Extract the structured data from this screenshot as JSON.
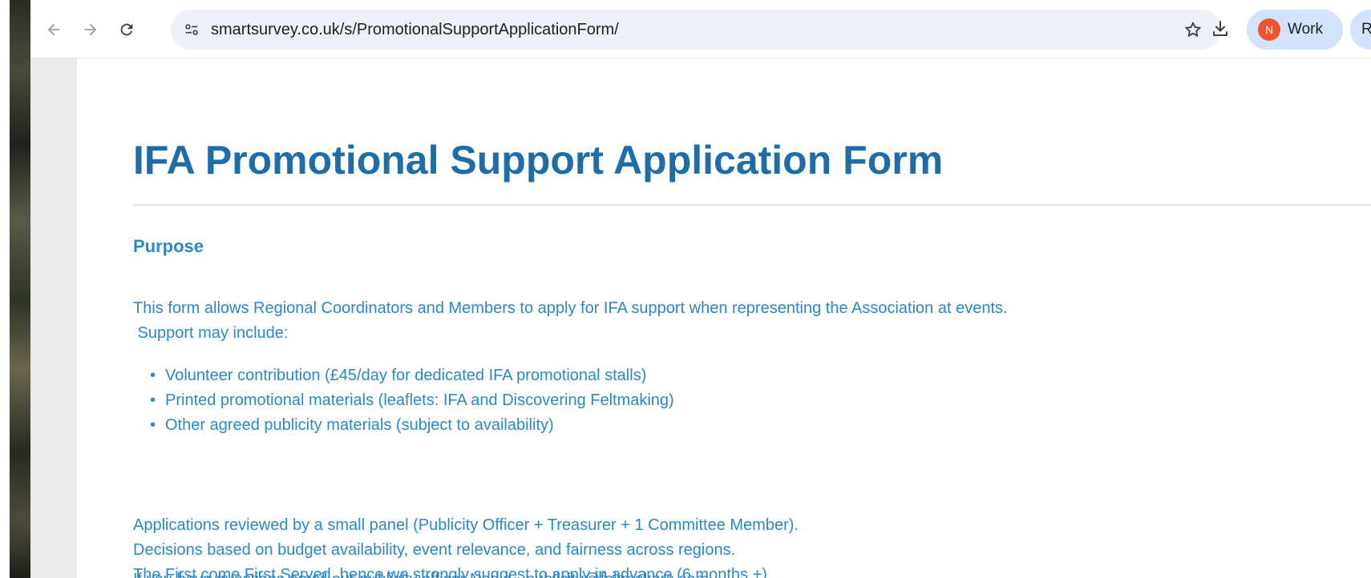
{
  "browser": {
    "url": "smartsurvey.co.uk/s/PromotionalSupportApplicationForm/",
    "profile_label": "Work",
    "profile_initial": "N",
    "second_chip_label": "Re",
    "icons": {
      "back": "back-arrow-icon",
      "forward": "forward-arrow-icon",
      "reload": "reload-icon",
      "tune": "site-info-icon",
      "bookmark": "star-icon",
      "download": "download-icon"
    }
  },
  "form": {
    "title": "IFA Promotional Support Application Form",
    "purpose_heading": "Purpose",
    "intro_lines": [
      "This form allows Regional Coordinators and Members to apply for IFA support when representing the Association at events.",
      " Support may include:"
    ],
    "bullets": [
      "Volunteer contribution (£45/day for dedicated IFA promotional stalls)",
      "Printed promotional materials (leaflets: IFA and Discovering Feltmaking)",
      "Other agreed publicity materials (subject to availability)"
    ],
    "review_lines": [
      "Applications reviewed by a small panel (Publicity Officer + Treasurer + 1 Committee Member).",
      "Decisions based on budget availability, event relevance, and fairness across regions.",
      "The First come First Served, hence we strongly suggest to apply in advance (6 months +)"
    ],
    "contact_line": "If you have questions email our publicity officer Nadia - publicity@feltmakers.com"
  },
  "colors": {
    "title": "#1e6da8",
    "body_text": "#2a88c6",
    "omnibox_bg": "#eef1f8",
    "profile_chip_bg": "#d3e3fd",
    "avatar_bg": "#f0542a",
    "gutter": "#ebebeb"
  }
}
